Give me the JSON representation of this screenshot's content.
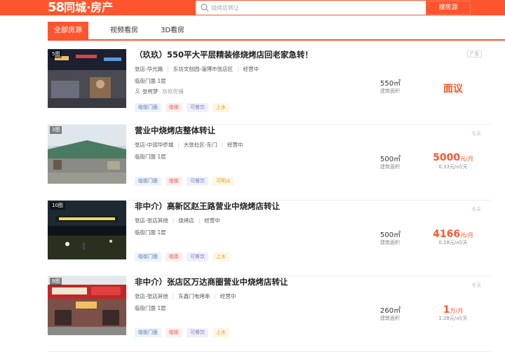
{
  "header": {
    "logo_num": "58",
    "logo_text": "同城·房产",
    "search_placeholder": "烧烤店转让",
    "search_button": "搜房源",
    "brand_color": "#ff552e"
  },
  "tabs": [
    {
      "label": "全部房源",
      "active": true
    },
    {
      "label": "视频看房",
      "active": false
    },
    {
      "label": "3D看房",
      "active": false
    }
  ],
  "listings": [
    {
      "img_count": "5图",
      "title": "（玖玖）550平大平层精装修烧烤店回老家急转！",
      "meta": [
        "张店-华光路",
        "东坊文创园-淄博市张店区",
        "经营中"
      ],
      "floor": "临街门面 1层",
      "agent": "张柯梦",
      "agent_shop": "玖玖优铺",
      "tags": [
        "临街门面",
        "临街",
        "可餐饮",
        "上水"
      ],
      "area": "550㎡",
      "area_label": "建筑面积",
      "price": "面议",
      "price_unit": "",
      "unit_price": "",
      "badge": "广告"
    },
    {
      "img_count": "3图",
      "title": "营业中烧烤店整体转让",
      "meta": [
        "张店-中润华侨城",
        "大张社区-东门",
        "经营中"
      ],
      "floor": "临街门面 1层",
      "tags": [
        "临街门面",
        "临街",
        "可餐饮",
        "可明火"
      ],
      "area": "500㎡",
      "area_label": "建筑面积",
      "price": "5000",
      "price_unit": "元/月",
      "unit_price": "0.33元/㎡/天",
      "date": "今天"
    },
    {
      "img_count": "10图",
      "title": "非中介）高新区赵王路营业中烧烤店转让",
      "meta": [
        "张店-张店其他",
        "烧烤店",
        "经营中"
      ],
      "floor": "临街门面 1层",
      "tags": [
        "临街门面",
        "临街",
        "可餐饮",
        "上水"
      ],
      "area": "500㎡",
      "area_label": "建筑面积",
      "price": "4166",
      "price_unit": "元/月",
      "unit_price": "0.28元/㎡/天",
      "date": "今天"
    },
    {
      "img_count": "9图",
      "title": "非中介）张店区万达商圈营业中烧烤店转让",
      "meta": [
        "张店-张店其他",
        "东鑫门电烤串",
        "经营中"
      ],
      "floor": "临街门面 1层",
      "tags": [
        "临街门面",
        "临街",
        "可餐饮",
        "上水"
      ],
      "area": "260㎡",
      "area_label": "建筑面积",
      "price": "1",
      "price_unit": "万/月",
      "unit_price": "1.28元/㎡/天",
      "date": "今天"
    }
  ]
}
